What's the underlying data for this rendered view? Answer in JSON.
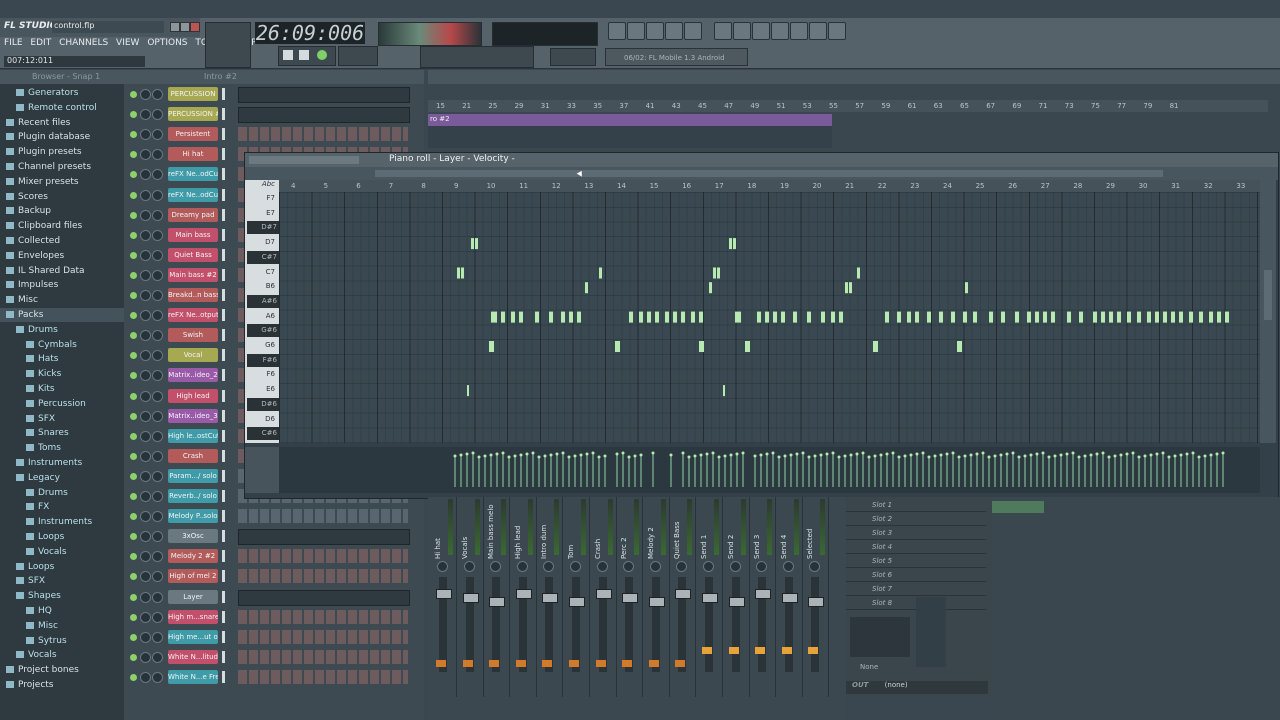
{
  "app": {
    "logo": "FL STUDIO",
    "filename": "control.flp",
    "menu": [
      "FILE",
      "EDIT",
      "CHANNELS",
      "VIEW",
      "OPTIONS",
      "TOOLS",
      "HELP"
    ],
    "time_readout": "007:12:011",
    "song_position": "26:09:006",
    "hint_text": "06/02: FL Mobile 1.3 Android"
  },
  "browser": {
    "title": "Browser - Snap 1",
    "items": [
      {
        "label": "Generators",
        "level": 2,
        "folder": false
      },
      {
        "label": "Remote control",
        "level": 2,
        "folder": false
      },
      {
        "label": "Recent files",
        "level": 1,
        "folder": true
      },
      {
        "label": "Plugin database",
        "level": 1,
        "folder": true
      },
      {
        "label": "Plugin presets",
        "level": 1,
        "folder": true
      },
      {
        "label": "Channel presets",
        "level": 1,
        "folder": true
      },
      {
        "label": "Mixer presets",
        "level": 1,
        "folder": true
      },
      {
        "label": "Scores",
        "level": 1,
        "folder": true
      },
      {
        "label": "Backup",
        "level": 1,
        "folder": true
      },
      {
        "label": "Clipboard files",
        "level": 1,
        "folder": true
      },
      {
        "label": "Collected",
        "level": 1,
        "folder": true
      },
      {
        "label": "Envelopes",
        "level": 1,
        "folder": true
      },
      {
        "label": "IL Shared Data",
        "level": 1,
        "folder": true
      },
      {
        "label": "Impulses",
        "level": 1,
        "folder": true
      },
      {
        "label": "Misc",
        "level": 1,
        "folder": true
      },
      {
        "label": "Packs",
        "level": 1,
        "folder": true,
        "selected": true
      },
      {
        "label": "Drums",
        "level": 2,
        "folder": true
      },
      {
        "label": "Cymbals",
        "level": 3,
        "folder": true
      },
      {
        "label": "Hats",
        "level": 3,
        "folder": true
      },
      {
        "label": "Kicks",
        "level": 3,
        "folder": true
      },
      {
        "label": "Kits",
        "level": 3,
        "folder": true
      },
      {
        "label": "Percussion",
        "level": 3,
        "folder": true
      },
      {
        "label": "SFX",
        "level": 3,
        "folder": true
      },
      {
        "label": "Snares",
        "level": 3,
        "folder": true
      },
      {
        "label": "Toms",
        "level": 3,
        "folder": true
      },
      {
        "label": "Instruments",
        "level": 2,
        "folder": true
      },
      {
        "label": "Legacy",
        "level": 2,
        "folder": true
      },
      {
        "label": "Drums",
        "level": 3,
        "folder": true
      },
      {
        "label": "FX",
        "level": 3,
        "folder": true
      },
      {
        "label": "Instruments",
        "level": 3,
        "folder": true
      },
      {
        "label": "Loops",
        "level": 3,
        "folder": true
      },
      {
        "label": "Vocals",
        "level": 3,
        "folder": true
      },
      {
        "label": "Loops",
        "level": 2,
        "folder": true
      },
      {
        "label": "SFX",
        "level": 2,
        "folder": true
      },
      {
        "label": "Shapes",
        "level": 2,
        "folder": true
      },
      {
        "label": "HQ",
        "level": 3,
        "folder": true
      },
      {
        "label": "Misc",
        "level": 3,
        "folder": true
      },
      {
        "label": "Sytrus",
        "level": 3,
        "folder": true
      },
      {
        "label": "Vocals",
        "level": 2,
        "folder": true
      },
      {
        "label": "Project bones",
        "level": 1,
        "folder": true
      },
      {
        "label": "Projects",
        "level": 1,
        "folder": true
      }
    ]
  },
  "channel_rack": {
    "pattern": "Intro #2",
    "channels": [
      {
        "name": "PERCUSSION",
        "color": "#a7a852",
        "type": "minipr"
      },
      {
        "name": "PERCUSSION #2",
        "color": "#a7a852",
        "type": "minipr"
      },
      {
        "name": "Persistent",
        "color": "#b35a5a",
        "type": "steps"
      },
      {
        "name": "Hi hat",
        "color": "#b35a5a",
        "type": "steps"
      },
      {
        "name": "reFX Ne..odCut",
        "color": "#3f9ba8",
        "type": "steps"
      },
      {
        "name": "reFX Ne..odCut",
        "color": "#3f9ba8",
        "type": "steps"
      },
      {
        "name": "Dreamy pad",
        "color": "#b35a5a",
        "type": "steps"
      },
      {
        "name": "Main bass",
        "color": "#c2506a",
        "type": "steps"
      },
      {
        "name": "Quiet Bass",
        "color": "#c2506a",
        "type": "steps"
      },
      {
        "name": "Main bass #2",
        "color": "#c2506a",
        "type": "steps"
      },
      {
        "name": "Breakd..n bass",
        "color": "#b35a5a",
        "type": "steps"
      },
      {
        "name": "reFX Ne..otput",
        "color": "#c2506a",
        "type": "steps"
      },
      {
        "name": "Swish",
        "color": "#b35a5a",
        "type": "steps"
      },
      {
        "name": "Vocal",
        "color": "#a7a852",
        "type": "steps"
      },
      {
        "name": "Matrix..ideo_2",
        "color": "#9a5aa8",
        "type": "steps"
      },
      {
        "name": "High lead",
        "color": "#c2506a",
        "type": "steps"
      },
      {
        "name": "Matrix..ideo_3",
        "color": "#9a5aa8",
        "type": "steps"
      },
      {
        "name": "High le..ostCut",
        "color": "#3f9ba8",
        "type": "steps"
      },
      {
        "name": "Crash",
        "color": "#b35a5a",
        "type": "steps"
      },
      {
        "name": "Param.../ solo",
        "color": "#3f9ba8",
        "type": "blue"
      },
      {
        "name": "Reverb../ solo",
        "color": "#3f9ba8",
        "type": "blue"
      },
      {
        "name": "Melody P..solo",
        "color": "#3f9ba8",
        "type": "blue"
      },
      {
        "name": "3xOsc",
        "color": "#6a7880",
        "type": "minipr"
      },
      {
        "name": "Melody 2 #2",
        "color": "#b35a5a",
        "type": "steps"
      },
      {
        "name": "High of mel 2",
        "color": "#b35a5a",
        "type": "steps"
      },
      {
        "name": "Layer",
        "color": "#6a7880",
        "type": "minipr"
      },
      {
        "name": "High m...snare",
        "color": "#c2506a",
        "type": "steps"
      },
      {
        "name": "High me...ut off",
        "color": "#3f9ba8",
        "type": "steps"
      },
      {
        "name": "White N...litude",
        "color": "#c2506a",
        "type": "steps"
      },
      {
        "name": "White N...e Freq",
        "color": "#3f9ba8",
        "type": "steps"
      }
    ]
  },
  "playlist": {
    "ruler": [
      "15",
      "21",
      "25",
      "29",
      "31",
      "33",
      "35",
      "37",
      "41",
      "43",
      "45",
      "47",
      "49",
      "51",
      "53",
      "55",
      "57",
      "59",
      "61",
      "63",
      "65",
      "67",
      "69",
      "71",
      "73",
      "75",
      "77",
      "79",
      "81"
    ],
    "clip_label": "ro #2"
  },
  "piano_roll": {
    "title": "Piano roll - Layer - Velocity -",
    "ruler": [
      "4",
      "5",
      "6",
      "7",
      "8",
      "9",
      "10",
      "11",
      "12",
      "13",
      "14",
      "15",
      "16",
      "17",
      "18",
      "19",
      "20",
      "21",
      "22",
      "23",
      "24",
      "25",
      "26",
      "27",
      "28",
      "29",
      "30",
      "31",
      "32",
      "33"
    ],
    "keys": [
      {
        "n": "F7",
        "black": false
      },
      {
        "n": "E7",
        "black": false
      },
      {
        "n": "D#7",
        "black": true
      },
      {
        "n": "D7",
        "black": false
      },
      {
        "n": "C#7",
        "black": true
      },
      {
        "n": "C7",
        "black": false
      },
      {
        "n": "B6",
        "black": false
      },
      {
        "n": "A#6",
        "black": true
      },
      {
        "n": "A6",
        "black": false
      },
      {
        "n": "G#6",
        "black": true
      },
      {
        "n": "G6",
        "black": false
      },
      {
        "n": "F#6",
        "black": true
      },
      {
        "n": "F6",
        "black": false
      },
      {
        "n": "E6",
        "black": false
      },
      {
        "n": "D#6",
        "black": true
      },
      {
        "n": "D6",
        "black": false
      },
      {
        "n": "C#6",
        "black": true
      }
    ],
    "key_header": "Abc",
    "note_color": "#b6eab0"
  },
  "mixer": {
    "strips": [
      "Hi hat",
      "Vocals",
      "Main bass melo",
      "High lead",
      "Intro dum",
      "Tom",
      "Crash",
      "Perc 2",
      "Melody 2",
      "Quiet Bass",
      "Send 1",
      "Send 2",
      "Send 3",
      "Send 4",
      "Selected"
    ],
    "slots": [
      "Slot 1",
      "Slot 2",
      "Slot 3",
      "Slot 4",
      "Slot 5",
      "Slot 6",
      "Slot 7",
      "Slot 8"
    ],
    "out_label": "OUT",
    "out_value": "(none)",
    "none_label": "None"
  }
}
